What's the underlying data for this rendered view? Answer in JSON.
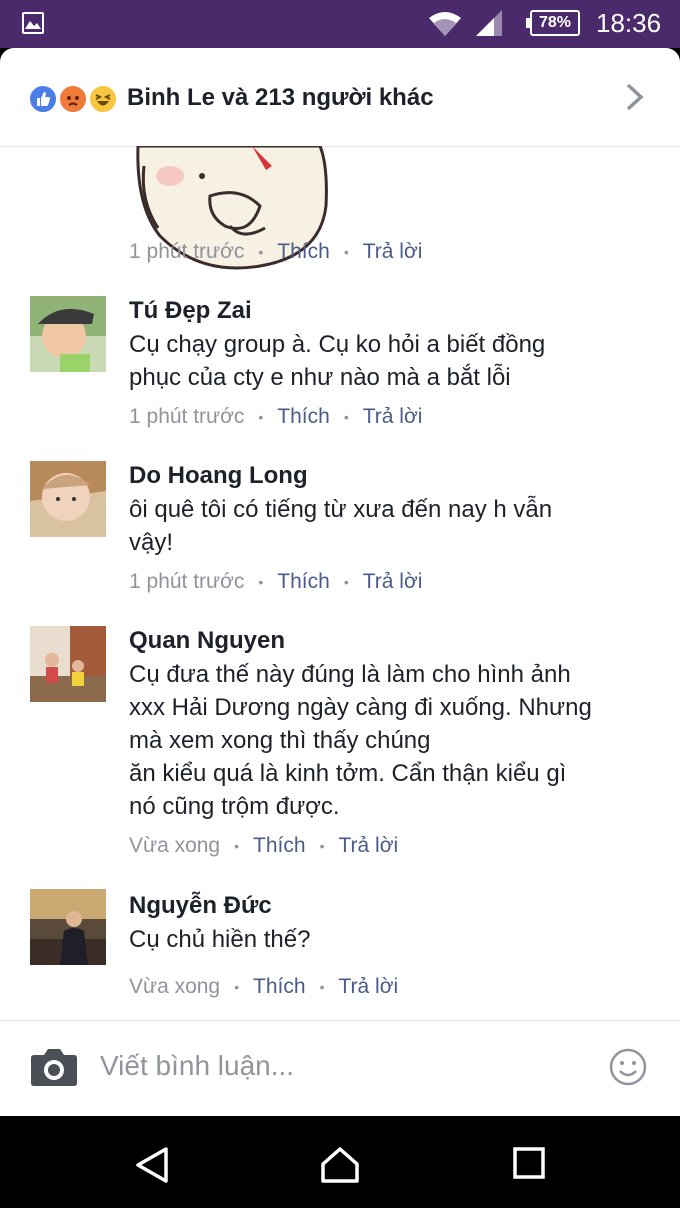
{
  "status_bar": {
    "battery": "78%",
    "time": "18:36"
  },
  "reactions": {
    "icons": [
      "like-icon",
      "angry-icon",
      "haha-icon"
    ],
    "summary": "Binh Le và 213 người khác"
  },
  "sticker_meta": {
    "time": "1 phút trước",
    "like": "Thích",
    "reply": "Trả lời"
  },
  "comments": [
    {
      "name": "Tú Đẹp Zai",
      "lines": [
        "Cụ chạy group à. Cụ ko hỏi a biết đồng",
        "phục của cty e như nào mà a bắt lỗi"
      ],
      "time": "1 phút trước",
      "like": "Thích",
      "reply": "Trả lời"
    },
    {
      "name": "Do Hoang Long",
      "lines": [
        "ôi quê tôi có tiếng từ xưa đến nay h vẫn",
        "vậy!"
      ],
      "time": "1 phút trước",
      "like": "Thích",
      "reply": "Trả lời"
    },
    {
      "name": "Quan Nguyen",
      "lines": [
        "Cụ đưa thế này đúng là làm cho hình ảnh",
        "xxx Hải Dương ngày càng đi xuống. Nhưng",
        "mà xem xong thì thấy chúng",
        "ăn kiểu quá là kinh tởm. Cẩn thận kiểu gì",
        "nó cũng trộm được."
      ],
      "time": "Vừa xong",
      "like": "Thích",
      "reply": "Trả lời"
    },
    {
      "name": "Nguyễn Đức",
      "lines": [
        "Cụ chủ hiền thế?"
      ],
      "time": "Vừa xong",
      "like": "Thích",
      "reply": "Trả lời"
    }
  ],
  "composer": {
    "placeholder": "Viết bình luận..."
  },
  "colors": {
    "status_bar": "#4a2a6b",
    "link": "#4b5b8a",
    "meta": "#90949c",
    "text": "#1d2129"
  }
}
